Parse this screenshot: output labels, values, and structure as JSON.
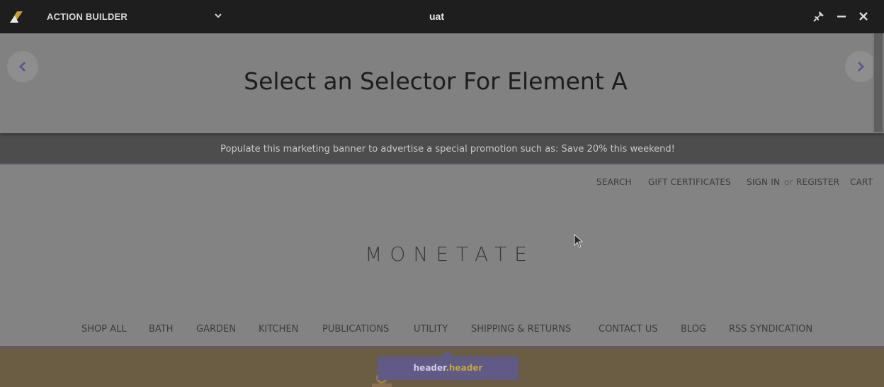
{
  "toolbar": {
    "title": "ACTION BUILDER",
    "environment": "uat"
  },
  "panel": {
    "title": "Select an Selector For Element A"
  },
  "promo": {
    "text": "Populate this marketing banner to advertise a special promotion such as: Save 20% this weekend!"
  },
  "site": {
    "utility_links": {
      "search": "SEARCH",
      "gift_certificates": "GIFT CERTIFICATES",
      "sign_in": "SIGN IN",
      "or": "or",
      "register": "REGISTER",
      "cart": "CART"
    },
    "brand": "MONETATE",
    "nav": [
      "SHOP ALL",
      "BATH",
      "GARDEN",
      "KITCHEN",
      "PUBLICATIONS",
      "UTILITY",
      "SHIPPING & RETURNS",
      "CONTACT US",
      "BLOG",
      "RSS SYNDICATION"
    ]
  },
  "tooltip": {
    "tag": "header",
    "class_sep": ".",
    "class_name": "header"
  },
  "colors": {
    "toolbar_bg": "#1e1e1e",
    "overlay_gray": "#838383",
    "promo_bg": "#4d4d4d",
    "tooltip_bg": "#5f5a86",
    "tooltip_class": "#c8a436",
    "nav_arrow": "#5e5a8c",
    "logo_gold": "#c9a227"
  },
  "icons": [
    "logo-icon",
    "chevron-down-icon",
    "pin-icon",
    "minimize-icon",
    "close-icon",
    "chevron-left-icon",
    "chevron-right-icon",
    "mouse-cursor-icon"
  ]
}
